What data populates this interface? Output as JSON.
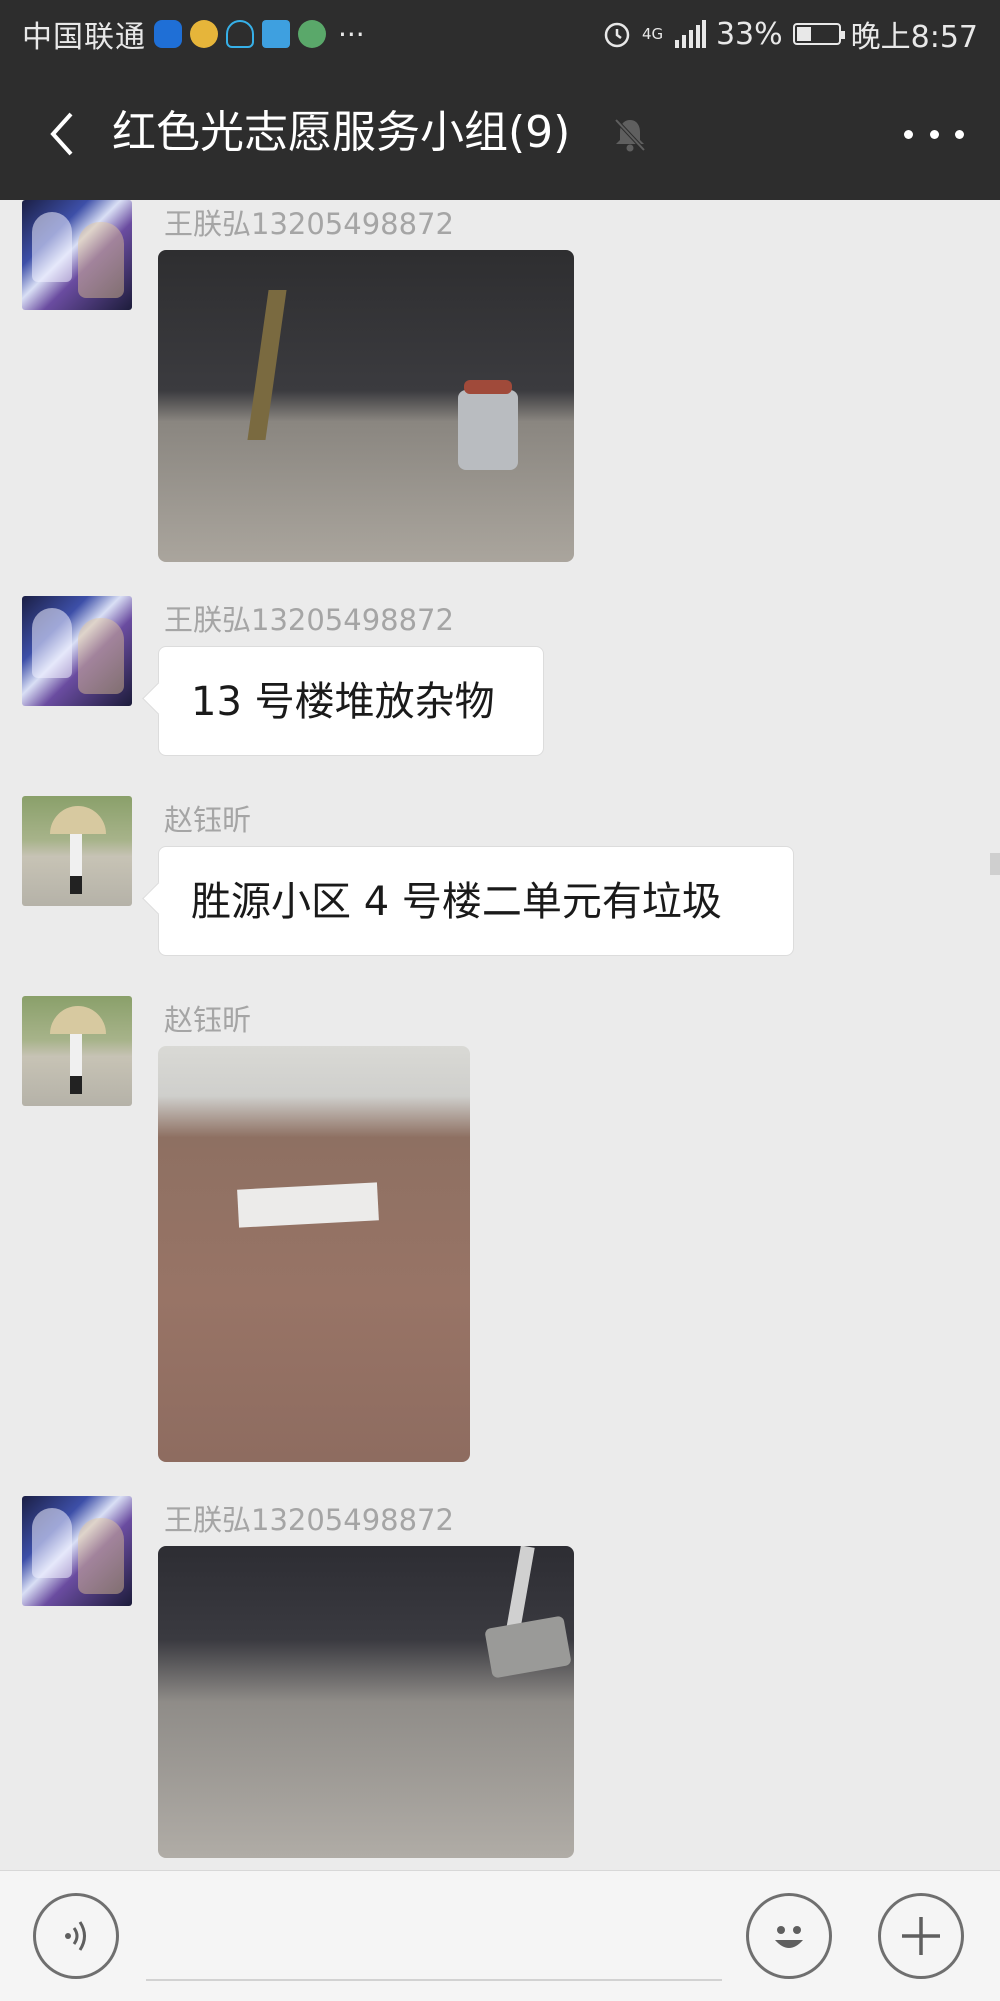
{
  "status_bar": {
    "carrier": "中国联通",
    "notification_more": "···",
    "network": "4G",
    "battery": "33%",
    "time": "晚上8:57"
  },
  "header": {
    "title": "红色光志愿服务小组(9)",
    "icons": [
      "back-arrow-icon",
      "mute-bell-icon",
      "more-icon"
    ]
  },
  "messages": [
    {
      "sender": "王朕弘13205498872",
      "type": "image",
      "avatar": "anime-avatar"
    },
    {
      "sender": "王朕弘13205498872",
      "type": "text",
      "text": "13 号楼堆放杂物",
      "avatar": "anime-avatar"
    },
    {
      "sender": "赵钰昕",
      "type": "text",
      "text": "胜源小区 4 号楼二单元有垃圾",
      "avatar": "photo-avatar"
    },
    {
      "sender": "赵钰昕",
      "type": "image",
      "avatar": "photo-avatar"
    },
    {
      "sender": "王朕弘13205498872",
      "type": "image",
      "avatar": "anime-avatar"
    }
  ],
  "input_bar": {
    "icons": [
      "voice-icon",
      "emoji-icon",
      "plus-icon"
    ]
  },
  "colors": {
    "header_bg": "#2d2d2d",
    "chat_bg": "#ebebeb",
    "bubble_bg": "#ffffff",
    "sender_text": "#a5a5a5"
  }
}
